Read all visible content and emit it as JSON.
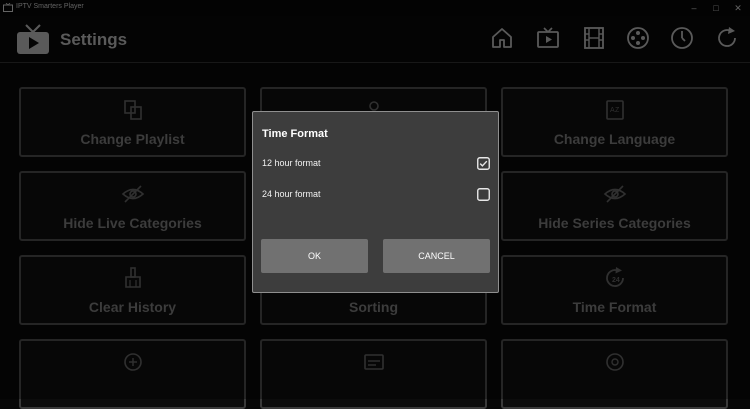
{
  "window": {
    "title": "IPTV Smarters Player"
  },
  "header": {
    "title": "Settings"
  },
  "nav": {
    "icons": [
      "home-icon",
      "live-tv-icon",
      "movies-icon",
      "series-icon",
      "clock-icon",
      "refresh-icon"
    ]
  },
  "tiles": [
    {
      "label": "Change Playlist",
      "icon": "change-playlist-icon"
    },
    {
      "label": "",
      "icon": "parental-icon"
    },
    {
      "label": "Change Language",
      "icon": "language-icon"
    },
    {
      "label": "Hide Live Categories",
      "icon": "eye-off-icon"
    },
    {
      "label": "",
      "icon": "hidden-icon"
    },
    {
      "label": "Hide Series Categories",
      "icon": "eye-off-icon"
    },
    {
      "label": "Clear History",
      "icon": "broom-icon"
    },
    {
      "label": "Sorting",
      "icon": "sort-icon"
    },
    {
      "label": "Time Format",
      "icon": "time-24-icon"
    }
  ],
  "dialog": {
    "title": "Time Format",
    "options": [
      {
        "label": "12 hour format",
        "checked": true
      },
      {
        "label": "24 hour format",
        "checked": false
      }
    ],
    "ok_label": "OK",
    "cancel_label": "CANCEL"
  },
  "colors": {
    "background": "#070707",
    "dialog": "#3d3d3d",
    "button": "#717171",
    "tile_border": "#3a3a3a"
  }
}
